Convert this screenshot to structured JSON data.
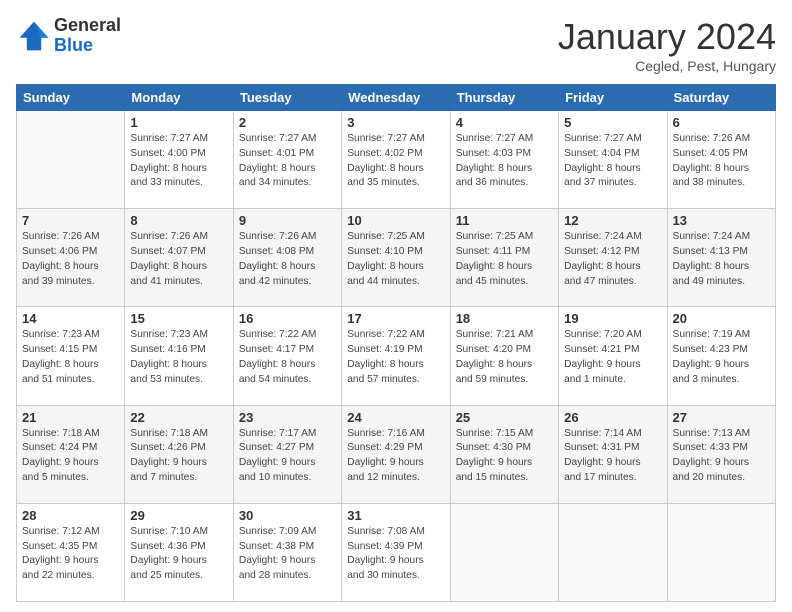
{
  "header": {
    "logo_general": "General",
    "logo_blue": "Blue",
    "month_title": "January 2024",
    "location": "Cegled, Pest, Hungary"
  },
  "weekdays": [
    "Sunday",
    "Monday",
    "Tuesday",
    "Wednesday",
    "Thursday",
    "Friday",
    "Saturday"
  ],
  "weeks": [
    [
      {
        "day": "",
        "info": ""
      },
      {
        "day": "1",
        "info": "Sunrise: 7:27 AM\nSunset: 4:00 PM\nDaylight: 8 hours\nand 33 minutes."
      },
      {
        "day": "2",
        "info": "Sunrise: 7:27 AM\nSunset: 4:01 PM\nDaylight: 8 hours\nand 34 minutes."
      },
      {
        "day": "3",
        "info": "Sunrise: 7:27 AM\nSunset: 4:02 PM\nDaylight: 8 hours\nand 35 minutes."
      },
      {
        "day": "4",
        "info": "Sunrise: 7:27 AM\nSunset: 4:03 PM\nDaylight: 8 hours\nand 36 minutes."
      },
      {
        "day": "5",
        "info": "Sunrise: 7:27 AM\nSunset: 4:04 PM\nDaylight: 8 hours\nand 37 minutes."
      },
      {
        "day": "6",
        "info": "Sunrise: 7:26 AM\nSunset: 4:05 PM\nDaylight: 8 hours\nand 38 minutes."
      }
    ],
    [
      {
        "day": "7",
        "info": "Sunrise: 7:26 AM\nSunset: 4:06 PM\nDaylight: 8 hours\nand 39 minutes."
      },
      {
        "day": "8",
        "info": "Sunrise: 7:26 AM\nSunset: 4:07 PM\nDaylight: 8 hours\nand 41 minutes."
      },
      {
        "day": "9",
        "info": "Sunrise: 7:26 AM\nSunset: 4:08 PM\nDaylight: 8 hours\nand 42 minutes."
      },
      {
        "day": "10",
        "info": "Sunrise: 7:25 AM\nSunset: 4:10 PM\nDaylight: 8 hours\nand 44 minutes."
      },
      {
        "day": "11",
        "info": "Sunrise: 7:25 AM\nSunset: 4:11 PM\nDaylight: 8 hours\nand 45 minutes."
      },
      {
        "day": "12",
        "info": "Sunrise: 7:24 AM\nSunset: 4:12 PM\nDaylight: 8 hours\nand 47 minutes."
      },
      {
        "day": "13",
        "info": "Sunrise: 7:24 AM\nSunset: 4:13 PM\nDaylight: 8 hours\nand 49 minutes."
      }
    ],
    [
      {
        "day": "14",
        "info": "Sunrise: 7:23 AM\nSunset: 4:15 PM\nDaylight: 8 hours\nand 51 minutes."
      },
      {
        "day": "15",
        "info": "Sunrise: 7:23 AM\nSunset: 4:16 PM\nDaylight: 8 hours\nand 53 minutes."
      },
      {
        "day": "16",
        "info": "Sunrise: 7:22 AM\nSunset: 4:17 PM\nDaylight: 8 hours\nand 54 minutes."
      },
      {
        "day": "17",
        "info": "Sunrise: 7:22 AM\nSunset: 4:19 PM\nDaylight: 8 hours\nand 57 minutes."
      },
      {
        "day": "18",
        "info": "Sunrise: 7:21 AM\nSunset: 4:20 PM\nDaylight: 8 hours\nand 59 minutes."
      },
      {
        "day": "19",
        "info": "Sunrise: 7:20 AM\nSunset: 4:21 PM\nDaylight: 9 hours\nand 1 minute."
      },
      {
        "day": "20",
        "info": "Sunrise: 7:19 AM\nSunset: 4:23 PM\nDaylight: 9 hours\nand 3 minutes."
      }
    ],
    [
      {
        "day": "21",
        "info": "Sunrise: 7:18 AM\nSunset: 4:24 PM\nDaylight: 9 hours\nand 5 minutes."
      },
      {
        "day": "22",
        "info": "Sunrise: 7:18 AM\nSunset: 4:26 PM\nDaylight: 9 hours\nand 7 minutes."
      },
      {
        "day": "23",
        "info": "Sunrise: 7:17 AM\nSunset: 4:27 PM\nDaylight: 9 hours\nand 10 minutes."
      },
      {
        "day": "24",
        "info": "Sunrise: 7:16 AM\nSunset: 4:29 PM\nDaylight: 9 hours\nand 12 minutes."
      },
      {
        "day": "25",
        "info": "Sunrise: 7:15 AM\nSunset: 4:30 PM\nDaylight: 9 hours\nand 15 minutes."
      },
      {
        "day": "26",
        "info": "Sunrise: 7:14 AM\nSunset: 4:31 PM\nDaylight: 9 hours\nand 17 minutes."
      },
      {
        "day": "27",
        "info": "Sunrise: 7:13 AM\nSunset: 4:33 PM\nDaylight: 9 hours\nand 20 minutes."
      }
    ],
    [
      {
        "day": "28",
        "info": "Sunrise: 7:12 AM\nSunset: 4:35 PM\nDaylight: 9 hours\nand 22 minutes."
      },
      {
        "day": "29",
        "info": "Sunrise: 7:10 AM\nSunset: 4:36 PM\nDaylight: 9 hours\nand 25 minutes."
      },
      {
        "day": "30",
        "info": "Sunrise: 7:09 AM\nSunset: 4:38 PM\nDaylight: 9 hours\nand 28 minutes."
      },
      {
        "day": "31",
        "info": "Sunrise: 7:08 AM\nSunset: 4:39 PM\nDaylight: 9 hours\nand 30 minutes."
      },
      {
        "day": "",
        "info": ""
      },
      {
        "day": "",
        "info": ""
      },
      {
        "day": "",
        "info": ""
      }
    ]
  ]
}
